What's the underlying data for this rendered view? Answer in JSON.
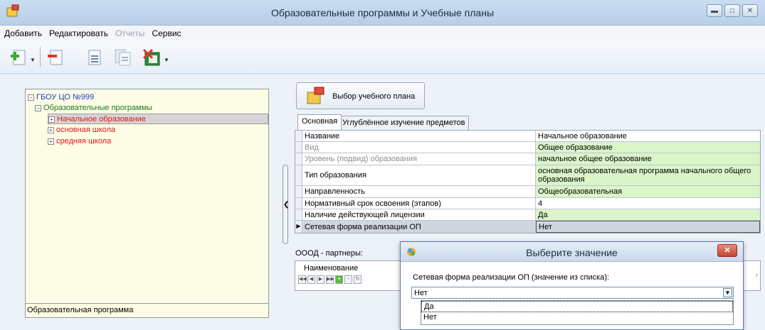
{
  "window": {
    "title": "Образовательные программы и Учебные планы"
  },
  "menu": [
    "Добавить",
    "Редактировать",
    "Отчеты",
    "Сервис"
  ],
  "menu_disabled_index": 2,
  "toolbar": {
    "icons": [
      "add-icon",
      "remove-icon",
      "document-icon",
      "copy-document-icon",
      "excel-export-icon"
    ]
  },
  "tree": {
    "root": "ГБОУ ЦО №999",
    "group": "Образовательные программы",
    "items": [
      "Начальное образование",
      "основная школа",
      "средняя школа"
    ],
    "selected_index": 0,
    "footer": "Образовательная программа"
  },
  "plan_button": {
    "label": "Выбор учебного плана"
  },
  "tabs": [
    "Основная",
    "Углублённое изучение предметов"
  ],
  "properties": [
    {
      "name": "Название",
      "value": "Начальное образование",
      "dim": false,
      "green": false
    },
    {
      "name": "Вид",
      "value": "Общее образование",
      "dim": true,
      "green": true
    },
    {
      "name": "Уровень (подвид) образования",
      "value": "начальное общее образование",
      "dim": true,
      "green": true
    },
    {
      "name": "Тип образования",
      "value": "основная образовательная программа начального общего образования",
      "dim": false,
      "green": true
    },
    {
      "name": "Направленность",
      "value": "Общеобразовательная",
      "dim": false,
      "green": true
    },
    {
      "name": "Нормативный срок освоения (этапов)",
      "value": "4",
      "dim": false,
      "green": false
    },
    {
      "name": "Наличие действующей лицензии",
      "value": "Да",
      "dim": false,
      "green": true
    },
    {
      "name": "Сетевая форма реализации ОП",
      "value": "Нет",
      "dim": false,
      "green": false
    }
  ],
  "partners": {
    "label": "ОООД - партнеры:",
    "column": "Наименование"
  },
  "dialog": {
    "title": "Выберите значение",
    "prompt": "Сетевая форма реализации ОП (значение из списка):",
    "selected": "Нет",
    "options": [
      "Да",
      "Нет"
    ]
  },
  "colors": {
    "green_cell": "#daf5c8",
    "tree_background": "#fdfde6",
    "tree_red": "#e0161b",
    "tree_green": "#1c7b1c",
    "tree_blue": "#1a3fbf"
  }
}
